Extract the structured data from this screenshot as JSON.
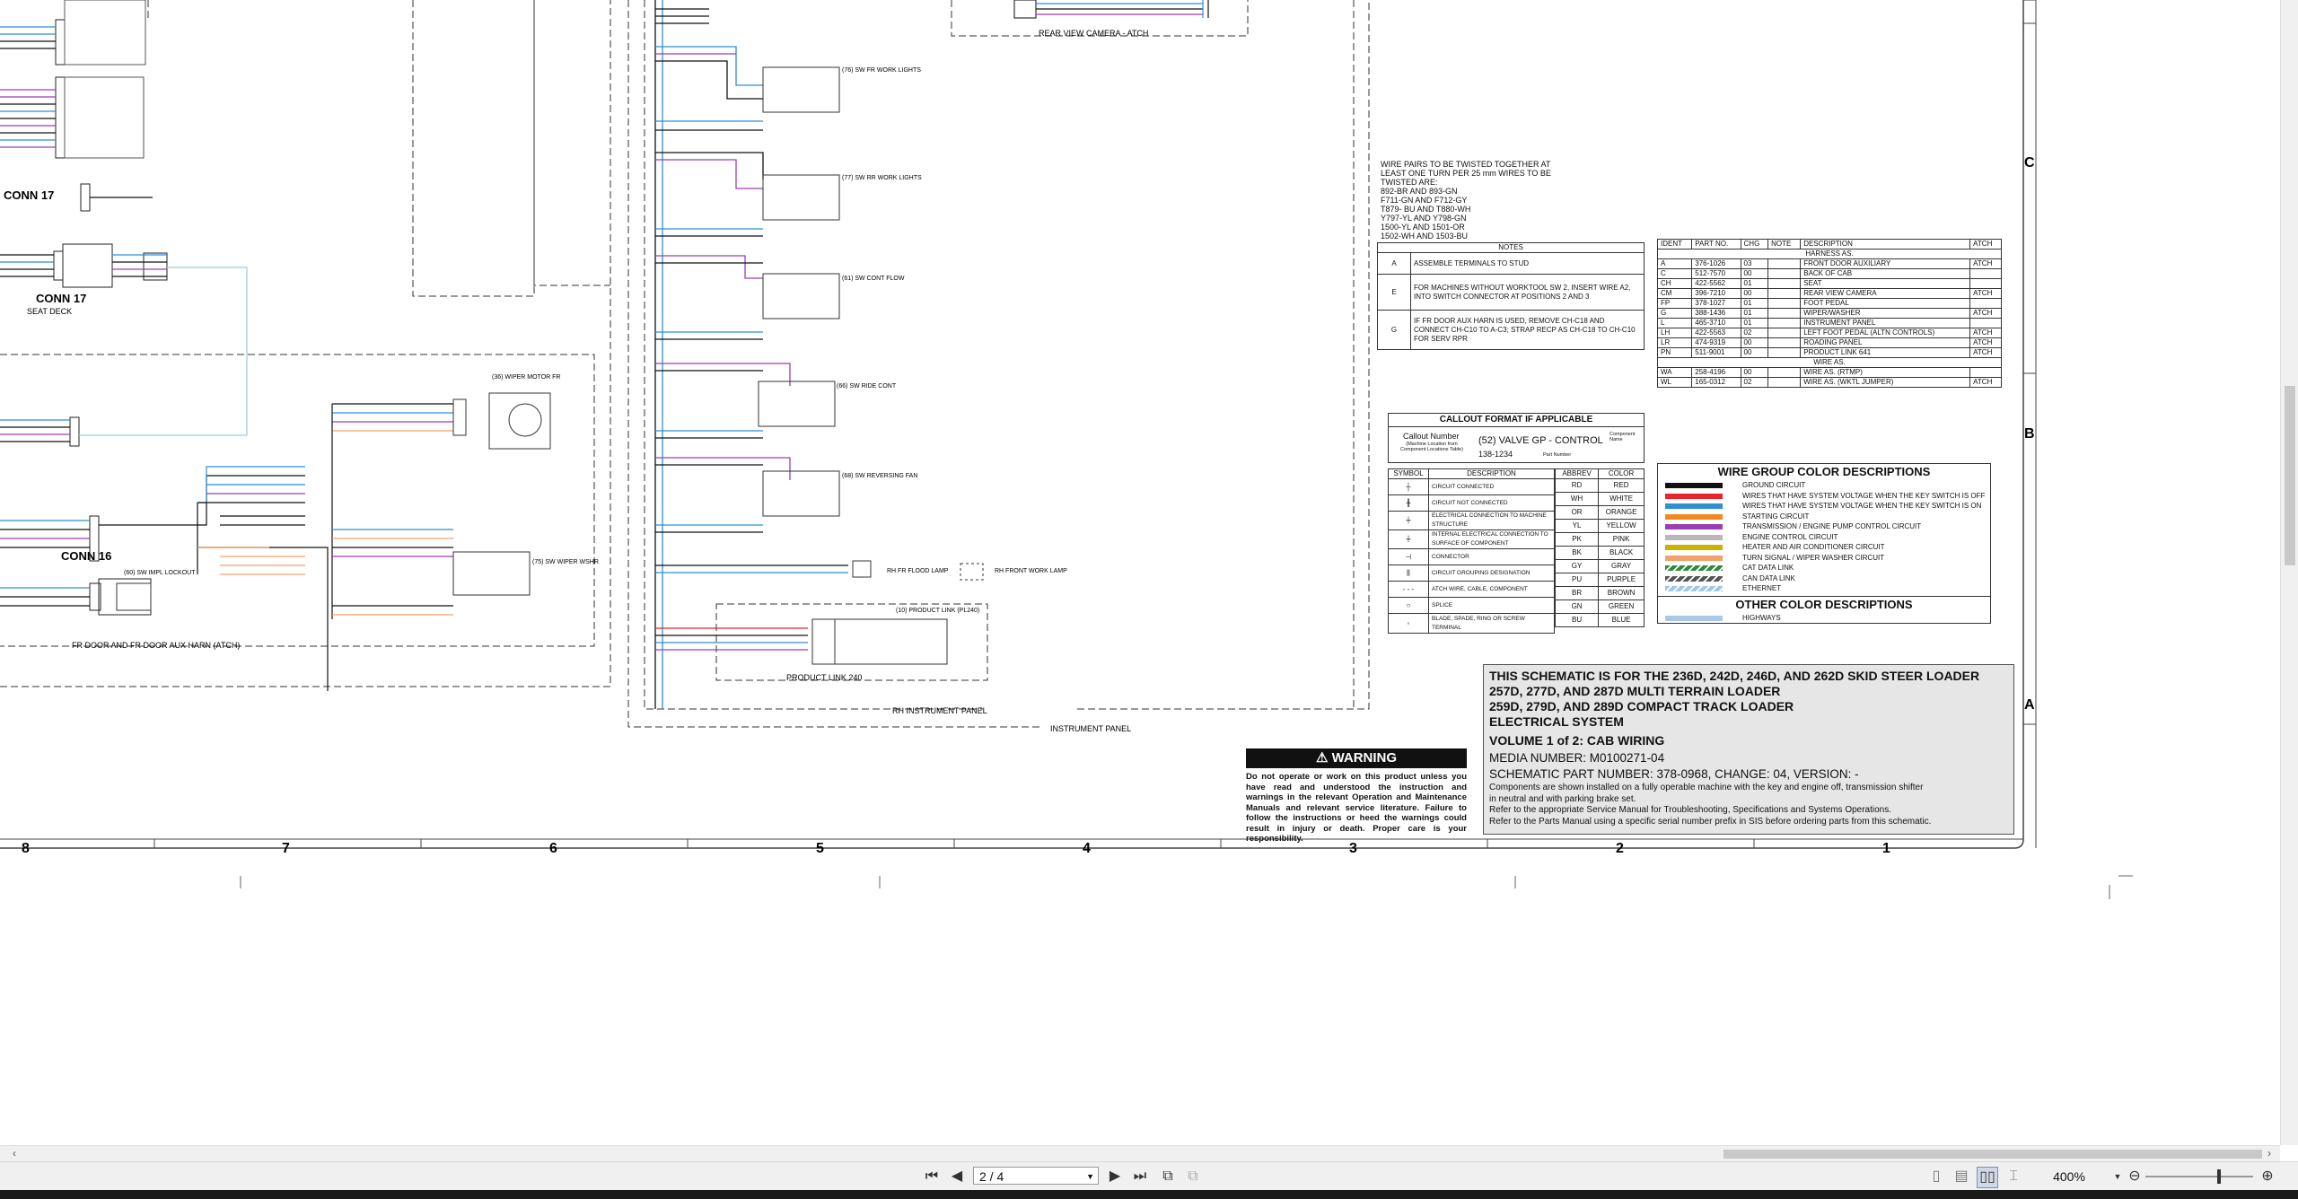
{
  "viewer": {
    "zone_letters": [
      "C",
      "B",
      "A"
    ],
    "zone_numbers": [
      "8",
      "7",
      "6",
      "5",
      "4",
      "3",
      "2",
      "1"
    ]
  },
  "schematic": {
    "conn_labels": {
      "conn17_a": "CONN 17",
      "conn17_b": "CONN 17",
      "conn16": "CONN 16",
      "seat_deck": "SEAT DECK",
      "fr_door_harn": "FR DOOR AND FR DOOR AUX HARN (ATCH)",
      "rear_view_camera": "REAR VIEW CAMERA - ATCH",
      "rh_instrument_panel": "RH INSTRUMENT PANEL",
      "instrument_panel": "INSTRUMENT PANEL",
      "product_link_240": "PRODUCT LINK 240",
      "wiper_motor_fr": "(36) WIPER MOTOR FR",
      "sw_wiper_wshr": "(75) SW WIPER WSHR",
      "sw_impl_lockout": "(60) SW IMPL LOCKOUT",
      "sw_fr_work_lights": "(76) SW FR WORK LIGHTS",
      "sw_rr_work_lights": "(77) SW RR WORK LIGHTS",
      "sw_cont_flow": "(61) SW CONT FLOW",
      "sw_ride_cont": "(66) SW RIDE CONT",
      "sw_reversing_fan": "(68) SW REVERSING FAN",
      "rh_fr_flood_lamp": "RH FR FLOOD LAMP",
      "rh_front_work_lamp": "RH FRONT WORK LAMP",
      "product_link": "(10) PRODUCT LINK (PL240)"
    },
    "twist_note": [
      "WIRE PAIRS TO BE TWISTED TOGETHER AT",
      "LEAST ONE TURN PER 25 mm WIRES TO BE",
      "TWISTED ARE:",
      "892-BR AND 893-GN",
      "F711-GN AND F712-GY",
      "T879- BU AND T880-WH",
      "Y797-YL AND Y798-GN",
      "1500-YL AND 1501-OR",
      "1502-WH AND 1503-BU"
    ],
    "notes": {
      "title": "NOTES",
      "rows": [
        {
          "id": "A",
          "text": "ASSEMBLE TERMINALS TO STUD"
        },
        {
          "id": "E",
          "text": "FOR MACHINES WITHOUT WORKTOOL SW 2, INSERT WIRE A2, INTO SWITCH CONNECTOR AT POSITIONS 2 AND 3"
        },
        {
          "id": "G",
          "text": "IF FR DOOR AUX HARN IS USED, REMOVE CH-C18 AND CONNECT CH-C10 TO A-C3; STRAP RECP AS CH-C18 TO CH-C10 FOR SERV RPR"
        }
      ]
    },
    "harness_table": {
      "headers": [
        "IDENT",
        "PART NO.",
        "CHG",
        "NOTE",
        "DESCRIPTION",
        "ATCH"
      ],
      "group1": "HARNESS AS.",
      "rows1": [
        [
          "A",
          "376-1026",
          "03",
          "",
          "FRONT DOOR AUXILIARY",
          "ATCH"
        ],
        [
          "C",
          "512-7570",
          "00",
          "",
          "BACK OF CAB",
          ""
        ],
        [
          "CH",
          "422-5562",
          "01",
          "",
          "SEAT",
          ""
        ],
        [
          "CM",
          "396-7210",
          "00",
          "",
          "REAR VIEW CAMERA",
          "ATCH"
        ],
        [
          "FP",
          "378-1027",
          "01",
          "",
          "FOOT PEDAL",
          ""
        ],
        [
          "G",
          "388-1436",
          "01",
          "",
          "WIPER/WASHER",
          "ATCH"
        ],
        [
          "L",
          "465-3710",
          "01",
          "",
          "INSTRUMENT PANEL",
          ""
        ],
        [
          "LH",
          "422-5563",
          "02",
          "",
          "LEFT FOOT PEDAL (ALTN CONTROLS)",
          "ATCH"
        ],
        [
          "LR",
          "474-9319",
          "00",
          "",
          "ROADING PANEL",
          "ATCH"
        ],
        [
          "PN",
          "511-9001",
          "00",
          "",
          "PRODUCT LINK 641",
          "ATCH"
        ]
      ],
      "group2": "WIRE AS.",
      "rows2": [
        [
          "WA",
          "258-4196",
          "00",
          "",
          "WIRE AS. (RTMP)",
          ""
        ],
        [
          "WL",
          "165-0312",
          "02",
          "",
          "WIRE AS. (WKTL JUMPER)",
          "ATCH"
        ]
      ]
    },
    "callout": {
      "title": "CALLOUT FORMAT IF APPLICABLE",
      "callout_number": "Callout Number",
      "machine_location": "(Machine Location from Component Locations Table)",
      "example": "(52) VALVE GP - CONTROL",
      "component_name": "Component Name",
      "part_number_value": "138-1234",
      "part_number_label": "Part Number"
    },
    "symbol_table": {
      "headers": [
        "SYMBOL",
        "DESCRIPTION"
      ],
      "rows": [
        [
          "CIRCUIT CONNECTED"
        ],
        [
          "CIRCUIT NOT CONNECTED"
        ],
        [
          "ELECTRICAL CONNECTION TO MACHINE STRUCTURE"
        ],
        [
          "INTERNAL ELECTRICAL CONNECTION TO SURFACE OF COMPONENT"
        ],
        [
          "CONNECTOR"
        ],
        [
          "CIRCUIT GROUPING DESIGNATION"
        ],
        [
          "ATCH WIRE, CABLE, COMPONENT"
        ],
        [
          "SPLICE"
        ],
        [
          "BLADE, SPADE, RING OR SCREW TERMINAL"
        ]
      ]
    },
    "abbrev_table": {
      "headers": [
        "ABBREV",
        "COLOR"
      ],
      "rows": [
        [
          "RD",
          "RED"
        ],
        [
          "WH",
          "WHITE"
        ],
        [
          "OR",
          "ORANGE"
        ],
        [
          "YL",
          "YELLOW"
        ],
        [
          "PK",
          "PINK"
        ],
        [
          "BK",
          "BLACK"
        ],
        [
          "GY",
          "GRAY"
        ],
        [
          "PU",
          "PURPLE"
        ],
        [
          "BR",
          "BROWN"
        ],
        [
          "GN",
          "GREEN"
        ],
        [
          "BU",
          "BLUE"
        ]
      ]
    },
    "wire_group": {
      "title": "WIRE GROUP COLOR DESCRIPTIONS",
      "rows": [
        {
          "label": "GROUND CIRCUIT",
          "color": "#111111"
        },
        {
          "label": "WIRES THAT HAVE SYSTEM VOLTAGE WHEN THE KEY SWITCH IS OFF",
          "color": "#e8262a"
        },
        {
          "label": "WIRES THAT HAVE SYSTEM VOLTAGE WHEN THE KEY SWITCH IS ON",
          "color": "#2f8fd0"
        },
        {
          "label": "STARTING CIRCUIT",
          "color": "#f08a1c"
        },
        {
          "label": "TRANSMISSION / ENGINE PUMP CONTROL CIRCUIT",
          "color": "#9b3fb5"
        },
        {
          "label": "ENGINE CONTROL CIRCUIT",
          "color": "#b8b8b8"
        },
        {
          "label": "HEATER AND AIR CONDITIONER CIRCUIT",
          "color": "#c8b400"
        },
        {
          "label": "TURN SIGNAL / WIPER WASHER CIRCUIT",
          "color": "#f2a26a"
        },
        {
          "label": "CAT DATA LINK",
          "color": "#2e8b3a"
        },
        {
          "label": "CAN DATA LINK",
          "color": "#555555"
        },
        {
          "label": "ETHERNET",
          "color": "#9ec9e6"
        }
      ],
      "other_title": "OTHER COLOR DESCRIPTIONS",
      "other_rows": [
        {
          "label": "HIGHWAYS",
          "color": "#a9c8e8"
        }
      ]
    },
    "warning": {
      "title": "WARNING",
      "body": "Do not operate or work on this product unless you have read and understood the instruction and warnings in the relevant Operation and Maintenance Manuals and relevant service literature. Failure to follow the instructions or heed the warnings could result in injury or death. Proper care is your responsibility."
    },
    "title_block": {
      "line1": "THIS SCHEMATIC IS FOR THE 236D, 242D, 246D, AND 262D SKID STEER LOADER",
      "line2": "257D, 277D, AND 287D MULTI TERRAIN LOADER",
      "line3": "259D, 279D, AND 289D COMPACT TRACK LOADER",
      "line4": "ELECTRICAL SYSTEM",
      "line5": "VOLUME 1 of 2: CAB WIRING",
      "media": "MEDIA NUMBER: M0100271-04",
      "part": "SCHEMATIC PART NUMBER: 378-0968, CHANGE: 04, VERSION: -",
      "note1": "Components are shown installed on a fully operable machine with the key and engine off, transmission shifter",
      "note2": "in neutral and with parking brake set.",
      "note3": "Refer to the appropriate Service Manual for Troubleshooting, Specifications and Systems Operations.",
      "note4": "Refer to the Parts Manual using a specific serial number prefix in SIS before ordering parts from this schematic."
    }
  },
  "toolbar": {
    "page_value": "2 / 4",
    "zoom": "400%"
  }
}
